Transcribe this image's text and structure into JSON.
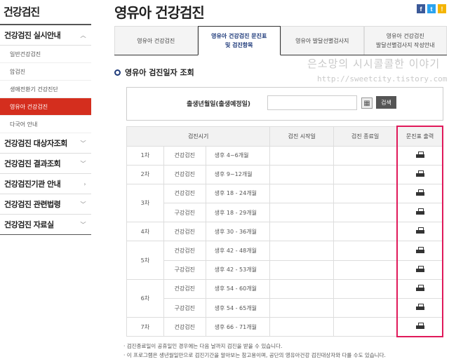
{
  "sidebar": {
    "title": "건강검진",
    "sections": [
      {
        "label": "건강검진 실시안내",
        "chevron": "︿"
      },
      {
        "label": "건강검진 대상자조회",
        "chevron": "﹀"
      },
      {
        "label": "건강검진 결과조회",
        "chevron": "﹀"
      },
      {
        "label": "건강검진기관 안내",
        "chevron": "›"
      },
      {
        "label": "건강검진 관련법령",
        "chevron": "﹀"
      },
      {
        "label": "건강검진 자료실",
        "chevron": "﹀"
      }
    ],
    "sub_items": [
      "일반건강검진",
      "암검진",
      "생애전환기 건강진단",
      "영유아 건강검진",
      "다국어 안내"
    ],
    "active_color": "#d42e1e"
  },
  "header": {
    "title": "영유아 건강검진",
    "social": {
      "facebook": "f",
      "twitter": "t",
      "kakao": "!"
    }
  },
  "tabs": [
    {
      "line1": "영유아 건강검진",
      "line2": ""
    },
    {
      "line1": "영유아 건강검진 문진표",
      "line2": "및 검진항목"
    },
    {
      "line1": "영유아 발달선별검사지",
      "line2": ""
    },
    {
      "line1": "영유아 건강검진",
      "line2": "발달선별검사지 작성안내"
    }
  ],
  "section": {
    "title": "영유아 검진일자 조회"
  },
  "watermark": {
    "line1": "은소망의 시시콜콜한 이야기",
    "line2": "http://sweetcity.tistory.com"
  },
  "search": {
    "label": "출생년월일(출생예정일)",
    "value": "",
    "button": "검색",
    "calendar_icon": "calendar-icon"
  },
  "table": {
    "headers": {
      "period": "검진시기",
      "start": "검진 시작일",
      "end": "검진 종료일",
      "print": "문진표 출력"
    },
    "rows": [
      {
        "round": "1차",
        "type": "건강검진",
        "age": "생후 4~6개월"
      },
      {
        "round": "2차",
        "type": "건강검진",
        "age": "생후 9~12개월"
      },
      {
        "round": "3차",
        "type": "건강검진",
        "age": "생후 18 - 24개월"
      },
      {
        "round": "",
        "type": "구강검진",
        "age": "생후 18 - 29개월"
      },
      {
        "round": "4차",
        "type": "건강검진",
        "age": "생후 30 - 36개월"
      },
      {
        "round": "5차",
        "type": "건강검진",
        "age": "생후 42 - 48개월"
      },
      {
        "round": "",
        "type": "구강검진",
        "age": "생후 42 - 53개월"
      },
      {
        "round": "6차",
        "type": "건강검진",
        "age": "생후 54 - 60개월"
      },
      {
        "round": "",
        "type": "구강검진",
        "age": "생후 54 - 65개월"
      },
      {
        "round": "7차",
        "type": "건강검진",
        "age": "생후 66 - 71개월"
      }
    ],
    "highlight_color": "#e0195a"
  },
  "notes": [
    "· 검진종료일이 공휴일인 경우에는 다음 날까지 검진을 받을 수 있습니다.",
    "· 이 프로그램은 생년월일만으로 검진기간을 알아보는 참고용이며, 공단의 영유아건강 검진대상자와 다를 수도 있습니다."
  ]
}
